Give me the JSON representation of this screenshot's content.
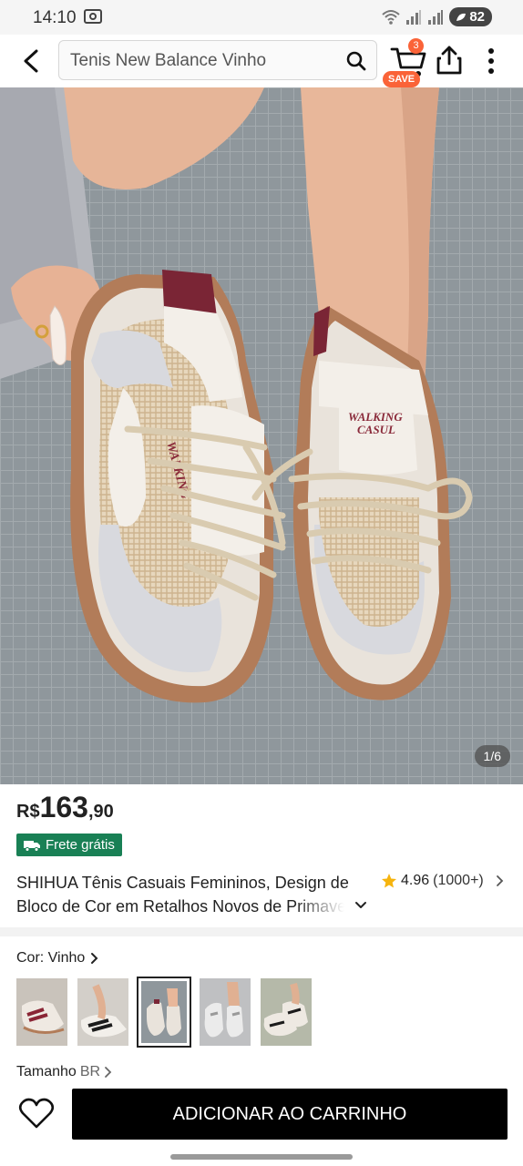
{
  "status_bar": {
    "time": "14:10",
    "battery": "82"
  },
  "header": {
    "search_query": "Tenis New Balance Vinho",
    "cart_count": "3",
    "save_tag": "SAVE"
  },
  "product_image": {
    "counter": "1/6",
    "shoe_text_left": "WALKING",
    "shoe_text_right": "WALKING CASUL"
  },
  "price": {
    "currency": "R$",
    "main": "163",
    "cents": ",90"
  },
  "shipping_badge": "Frete grátis",
  "title": {
    "line1": "SHIHUA Tênis Casuais Femininos, Design de",
    "line2": "Bloco de Cor em Retalhos Novos de Primavera"
  },
  "rating": {
    "score": "4.96",
    "count": "(1000+)"
  },
  "color_selector": {
    "label": "Cor: Vinho",
    "selected_index": 2,
    "swatch_count": 5
  },
  "size_selector": {
    "label": "Tamanho",
    "sub": "BR"
  },
  "bottom_bar": {
    "add_to_cart_label": "ADICIONAR AO CARRINHO"
  },
  "colors": {
    "accent_orange": "#fa6338",
    "shipping_green": "#198055",
    "star_yellow": "#f6b40e",
    "button_black": "#000000"
  }
}
